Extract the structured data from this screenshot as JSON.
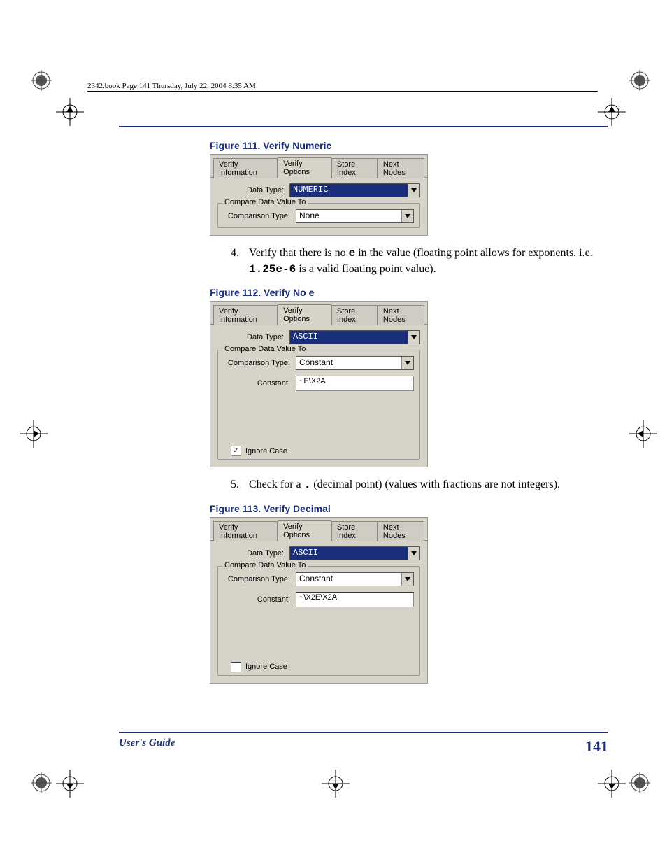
{
  "header": "2342.book  Page 141  Thursday, July 22, 2004  8:35 AM",
  "figures": {
    "f111": {
      "caption": "Figure 111. Verify Numeric",
      "tabs": [
        "Verify Information",
        "Verify Options",
        "Store Index",
        "Next Nodes"
      ],
      "active_tab": "Verify Options",
      "data_type_label": "Data Type:",
      "data_type_value": "NUMERIC",
      "fieldset_legend": "Compare Data Value To",
      "comparison_type_label": "Comparison Type:",
      "comparison_type_value": "None"
    },
    "f112": {
      "caption": "Figure 112. Verify No e",
      "tabs": [
        "Verify Information",
        "Verify Options",
        "Store Index",
        "Next Nodes"
      ],
      "active_tab": "Verify Options",
      "data_type_label": "Data Type:",
      "data_type_value": "ASCII",
      "fieldset_legend": "Compare Data Value To",
      "comparison_type_label": "Comparison Type:",
      "comparison_type_value": "Constant",
      "constant_label": "Constant:",
      "constant_value": "~E\\X2A",
      "ignore_case_label": "Ignore Case",
      "ignore_case_checked": true
    },
    "f113": {
      "caption": "Figure 113. Verify Decimal",
      "tabs": [
        "Verify Information",
        "Verify Options",
        "Store Index",
        "Next Nodes"
      ],
      "active_tab": "Verify Options",
      "data_type_label": "Data Type:",
      "data_type_value": "ASCII",
      "fieldset_legend": "Compare Data Value To",
      "comparison_type_label": "Comparison Type:",
      "comparison_type_value": "Constant",
      "constant_label": "Constant:",
      "constant_value": "~\\X2E\\X2A",
      "ignore_case_label": "Ignore Case",
      "ignore_case_checked": false
    }
  },
  "steps": {
    "s4": {
      "num": "4.",
      "text_pre": "Verify that there is no ",
      "mono1": "e",
      "text_mid": " in the value (floating point allows for exponents. i.e. ",
      "mono2": "1.25e-6",
      "text_post": " is a valid floating point value)."
    },
    "s5": {
      "num": "5.",
      "text_pre": "Check for a ",
      "mono1": ".",
      "text_post": " (decimal point) (values with fractions are not integers)."
    }
  },
  "footer": {
    "left": "User's Guide",
    "right": "141"
  }
}
